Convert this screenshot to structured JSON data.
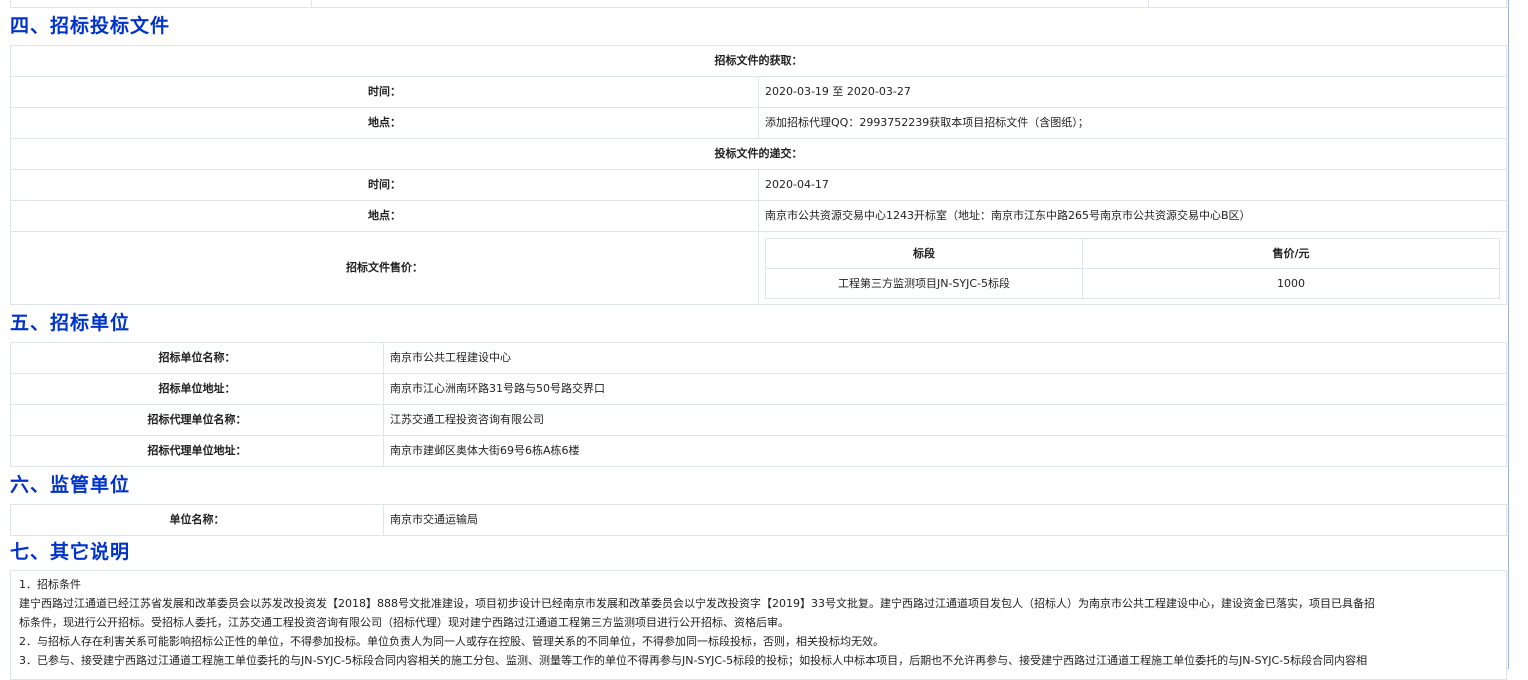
{
  "section4": {
    "heading": "四、招标投标文件",
    "obtain_title": "招标文件的获取：",
    "obtain_time_label": "时间：",
    "obtain_time_value": "2020-03-19 至 2020-03-27",
    "obtain_place_label": "地点：",
    "obtain_place_value": "添加招标代理QQ：2993752239获取本项目招标文件（含图纸）；",
    "submit_title": "投标文件的递交：",
    "submit_time_label": "时间：",
    "submit_time_value": "2020-04-17",
    "submit_place_label": "地点：",
    "submit_place_value": "南京市公共资源交易中心1243开标室（地址：南京市江东中路265号南京市公共资源交易中心B区）",
    "price_label": "招标文件售价：",
    "price_table": {
      "headers": [
        "标段",
        "售价/元"
      ],
      "rows": [
        [
          "工程第三方监测项目JN-SYJC-5标段",
          "1000"
        ]
      ]
    }
  },
  "section5": {
    "heading": "五、招标单位",
    "rows": [
      {
        "label": "招标单位名称：",
        "value": "南京市公共工程建设中心"
      },
      {
        "label": "招标单位地址：",
        "value": "南京市江心洲南环路31号路与50号路交界口"
      },
      {
        "label": "招标代理单位名称：",
        "value": "江苏交通工程投资咨询有限公司"
      },
      {
        "label": "招标代理单位地址：",
        "value": "南京市建邺区奥体大街69号6栋A栋6楼"
      }
    ]
  },
  "section6": {
    "heading": "六、监管单位",
    "rows": [
      {
        "label": "单位名称：",
        "value": "南京市交通运输局"
      }
    ]
  },
  "section7": {
    "heading": "七、其它说明",
    "lines": [
      "1．招标条件",
      "建宁西路过江通道已经江苏省发展和改革委员会以苏发改投资发【2018】888号文批准建设，项目初步设计已经南京市发展和改革委员会以宁发改投资字【2019】33号文批复。建宁西路过江通道项目发包人（招标人）为南京市公共工程建设中心，建设资金已落实，项目已具备招",
      "标条件，现进行公开招标。受招标人委托，江苏交通工程投资咨询有限公司（招标代理）现对建宁西路过江通道工程第三方监测项目进行公开招标、资格后审。",
      "2．与招标人存在利害关系可能影响招标公正性的单位，不得参加投标。单位负责人为同一人或存在控股、管理关系的不同单位，不得参加同一标段投标，否则，相关投标均无效。",
      "3．已参与、接受建宁西路过江通道工程施工单位委托的与JN-SYJC-5标段合同内容相关的施工分包、监测、测量等工作的单位不得再参与JN-SYJC-5标段的投标；如投标人中标本项目，后期也不允许再参与、接受建宁西路过江通道工程施工单位委托的与JN-SYJC-5标段合同内容相"
    ]
  }
}
